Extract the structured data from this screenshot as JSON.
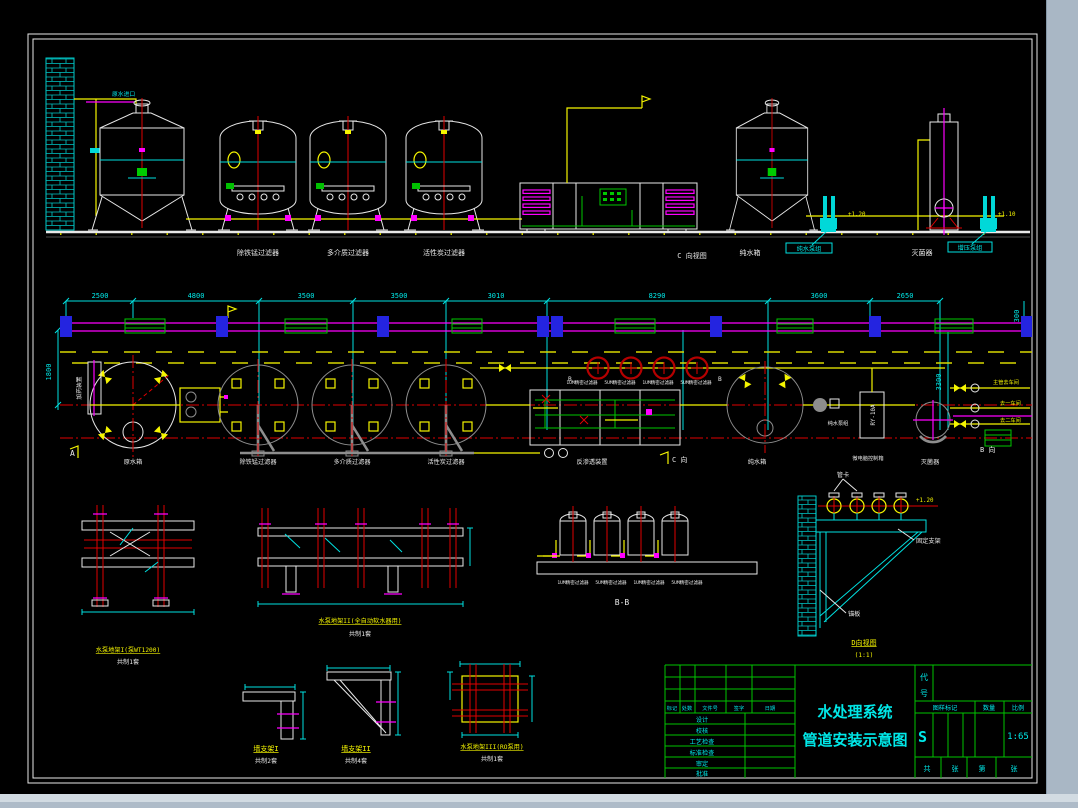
{
  "app": {
    "background": "#a9b7c5",
    "canvas": "#000000"
  },
  "title_block": {
    "title_line1": "水处理系统",
    "title_line2": "管道安装示意图",
    "code_label_1": "代",
    "code_label_2": "号",
    "header_cells": [
      "标记",
      "处数",
      "文件号",
      "签字",
      "日期"
    ],
    "row_labels": [
      "设计",
      "校核",
      "工艺检查",
      "标准检查",
      "审定",
      "批准"
    ],
    "mark_headers": [
      "图样标记",
      "数量",
      "比例"
    ],
    "mark_value": "S",
    "scale_value": "1:65",
    "sheet_cells": [
      "共",
      "张",
      "第",
      "张"
    ]
  },
  "elevation": {
    "equipment_labels": [
      "除铁锰过滤器",
      "多介质过滤器",
      "活性炭过滤器"
    ],
    "view_label": "C 向视图",
    "tank_label": "纯水箱",
    "sterilizer_label": "灭菌器",
    "pump_label_left": "纯水泵组",
    "pump_label_right": "增压泵组",
    "inlet_label": "原水进口",
    "elev_mark_left": "+1.20",
    "elev_mark_right": "+1.10"
  },
  "plan": {
    "dims_top": [
      "2500",
      "4800",
      "3500",
      "3500",
      "3010",
      "8290",
      "3600",
      "2650"
    ],
    "dim_left": "1800",
    "dim_right_300": "300",
    "dim_right_3300": "3300",
    "equipment_labels": [
      "原水箱",
      "除铁锰过滤器",
      "多介质过滤器",
      "活性炭过滤器",
      "反渗透装置",
      "纯水箱",
      "灭菌器"
    ],
    "pump_label": "纯水泵组",
    "controller_label": "微电脑控制箱",
    "device_code": "RY-10A",
    "dosing_label": "加药装置",
    "filter_labels": [
      "1UM精密过滤器",
      "5UM精密过滤器",
      "1UM精密过滤器",
      "5UM精密过滤器"
    ],
    "branch_labels": [
      "主管去车间",
      "去一车间",
      "去二车间"
    ],
    "view_c": "C 向",
    "view_b": "B 向",
    "section_a": "A",
    "section_b1": "B",
    "section_b2": "B"
  },
  "details": {
    "frame1_label": "水泵地架I(泵WT1200)",
    "frame1_qty": "共制1套",
    "frame2_label": "水泵地架II(全自动软水器用)",
    "frame2_qty": "共制1套",
    "section_bb": "B-B",
    "d_view_label": "D向视图",
    "d_view_scale": "(1:1)",
    "d_pipe_clamp": "管卡",
    "d_bracket": "固定支架",
    "d_anchor": "锚板",
    "d_elev_mark": "+1.20",
    "wall1_label": "墙支架I",
    "wall1_qty": "共制2套",
    "wall2_label": "墙支架II",
    "wall2_qty": "共制4套",
    "frame3_label": "水泵地架III(RO泵用)",
    "frame3_qty": "共制1套"
  }
}
